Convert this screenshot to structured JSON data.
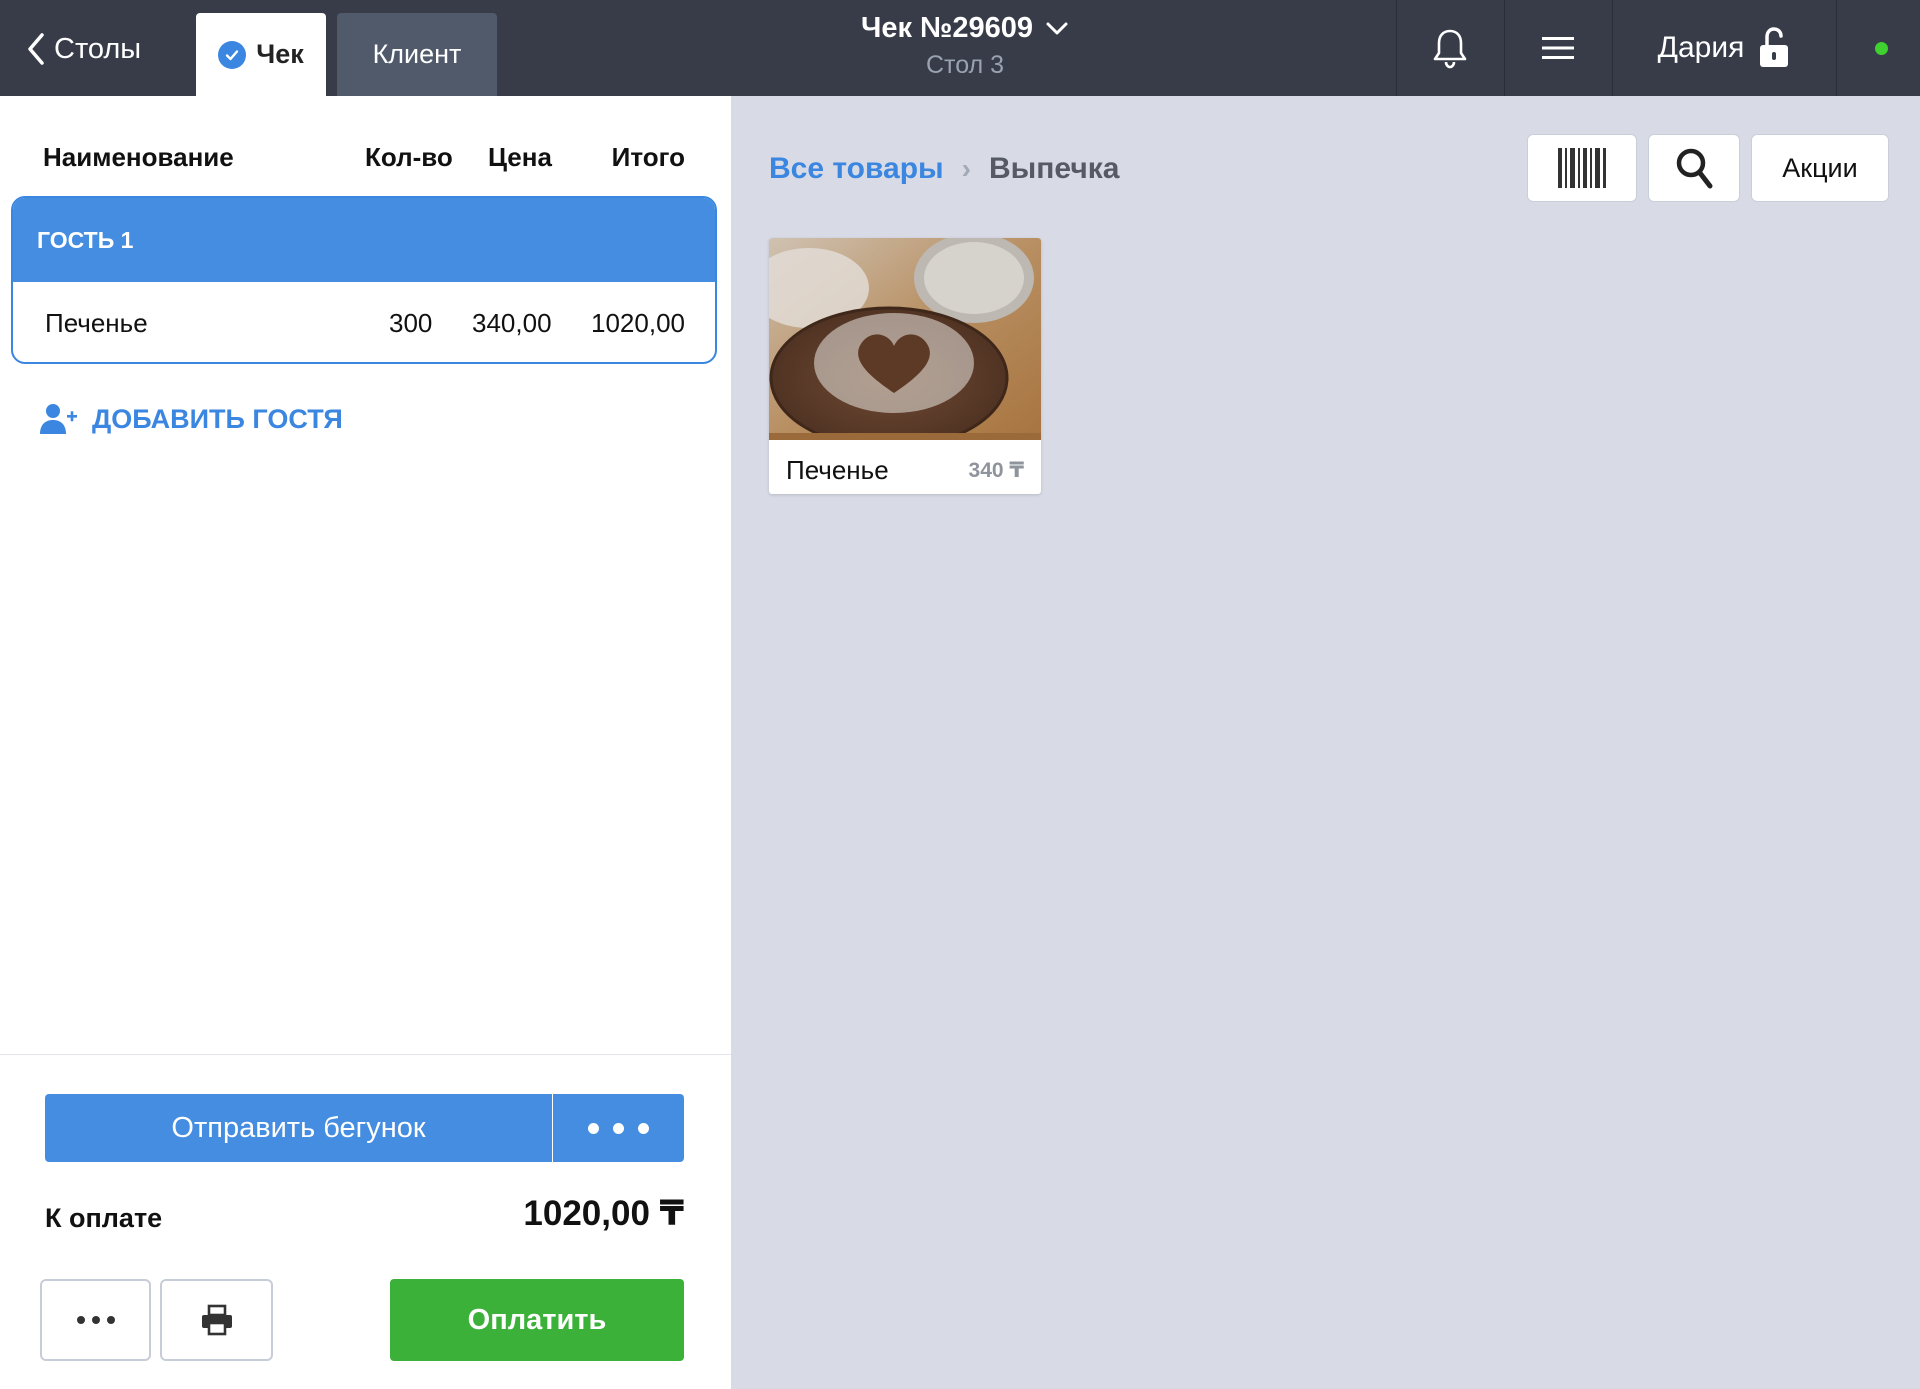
{
  "header": {
    "back_label": "Столы",
    "tabs": [
      {
        "label": "Чек",
        "active": true
      },
      {
        "label": "Клиент",
        "active": false
      }
    ],
    "receipt_title": "Чек №29609",
    "table_label": "Стол 3",
    "user_name": "Дария",
    "status_color": "#3fd12f",
    "icons": [
      "chevron-left-icon",
      "check-circle-icon",
      "chevron-down-icon",
      "bell-icon",
      "hamburger-menu-icon",
      "unlocked-padlock-icon"
    ]
  },
  "order": {
    "columns": {
      "name": "Наименование",
      "qty": "Кол-во",
      "price": "Цена",
      "total": "Итого"
    },
    "guests": [
      {
        "label": "ГОСТЬ 1",
        "items": [
          {
            "name": "Печенье",
            "qty": "300",
            "price": "340,00",
            "total": "1020,00"
          }
        ]
      }
    ],
    "add_guest_label": "ДОБАВИТЬ ГОСТЯ"
  },
  "footer": {
    "send_label": "Отправить бегунок",
    "to_pay_label": "К оплате",
    "to_pay_value": "1020,00 ₸",
    "pay_label": "Оплатить"
  },
  "catalog": {
    "breadcrumb_root": "Все товары",
    "breadcrumb_separator": "›",
    "breadcrumb_current": "Выпечка",
    "promo_label": "Акции",
    "products": [
      {
        "name": "Печенье",
        "price": "340 ₸"
      }
    ]
  },
  "colors": {
    "topbar": "#373c48",
    "accent_blue": "#448de0",
    "pay_green": "#3bb13a",
    "catalog_bg": "#d8dbe6"
  }
}
